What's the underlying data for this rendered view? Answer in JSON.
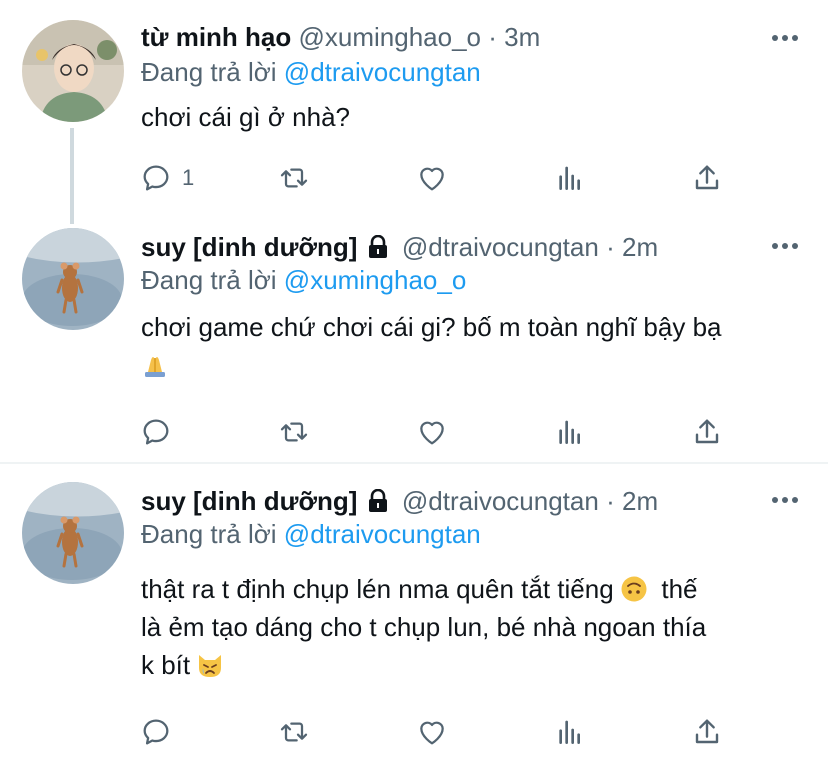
{
  "tweets": [
    {
      "name": "từ minh hạo",
      "handle": "@xuminghao_o",
      "time": "3m",
      "sep": "·",
      "replying_prefix": "Đang trả lời",
      "replying_to": "@dtraivocungtan",
      "text": "chơi cái gì ở nhà?",
      "reply_count": "1"
    },
    {
      "name": "suy [dinh dưỡng]",
      "handle": "@dtraivocungtan",
      "time": "2m",
      "sep": "·",
      "replying_prefix": "Đang trả lời",
      "replying_to": "@xuminghao_o",
      "text": "chơi game chứ chơi cái gi? bố m toàn nghĩ bậy bạ",
      "emoji": "🙏"
    },
    {
      "name": "suy [dinh dưỡng]",
      "handle": "@dtraivocungtan",
      "time": "2m",
      "sep": "·",
      "replying_prefix": "Đang trả lời",
      "replying_to": "@dtraivocungtan",
      "text_line1": "thật ra t định chụp lén nma quên tắt tiếng",
      "text_line1_after": "thế",
      "text_line2": "là ẻm tạo dáng cho t chụp lun, bé nhà ngoan thía",
      "text_line3": "k bít",
      "emoji1": "🙃",
      "emoji2": "😿"
    }
  ],
  "icons": {
    "reply": "reply-icon",
    "retweet": "retweet-icon",
    "like": "like-icon",
    "analytics": "analytics-icon",
    "share": "share-icon",
    "more": "more-icon",
    "lock": "lock-icon"
  },
  "colors": {
    "link": "#1d9bf0",
    "muted": "#536471",
    "text": "#0f1419",
    "divider": "#eff3f4"
  }
}
